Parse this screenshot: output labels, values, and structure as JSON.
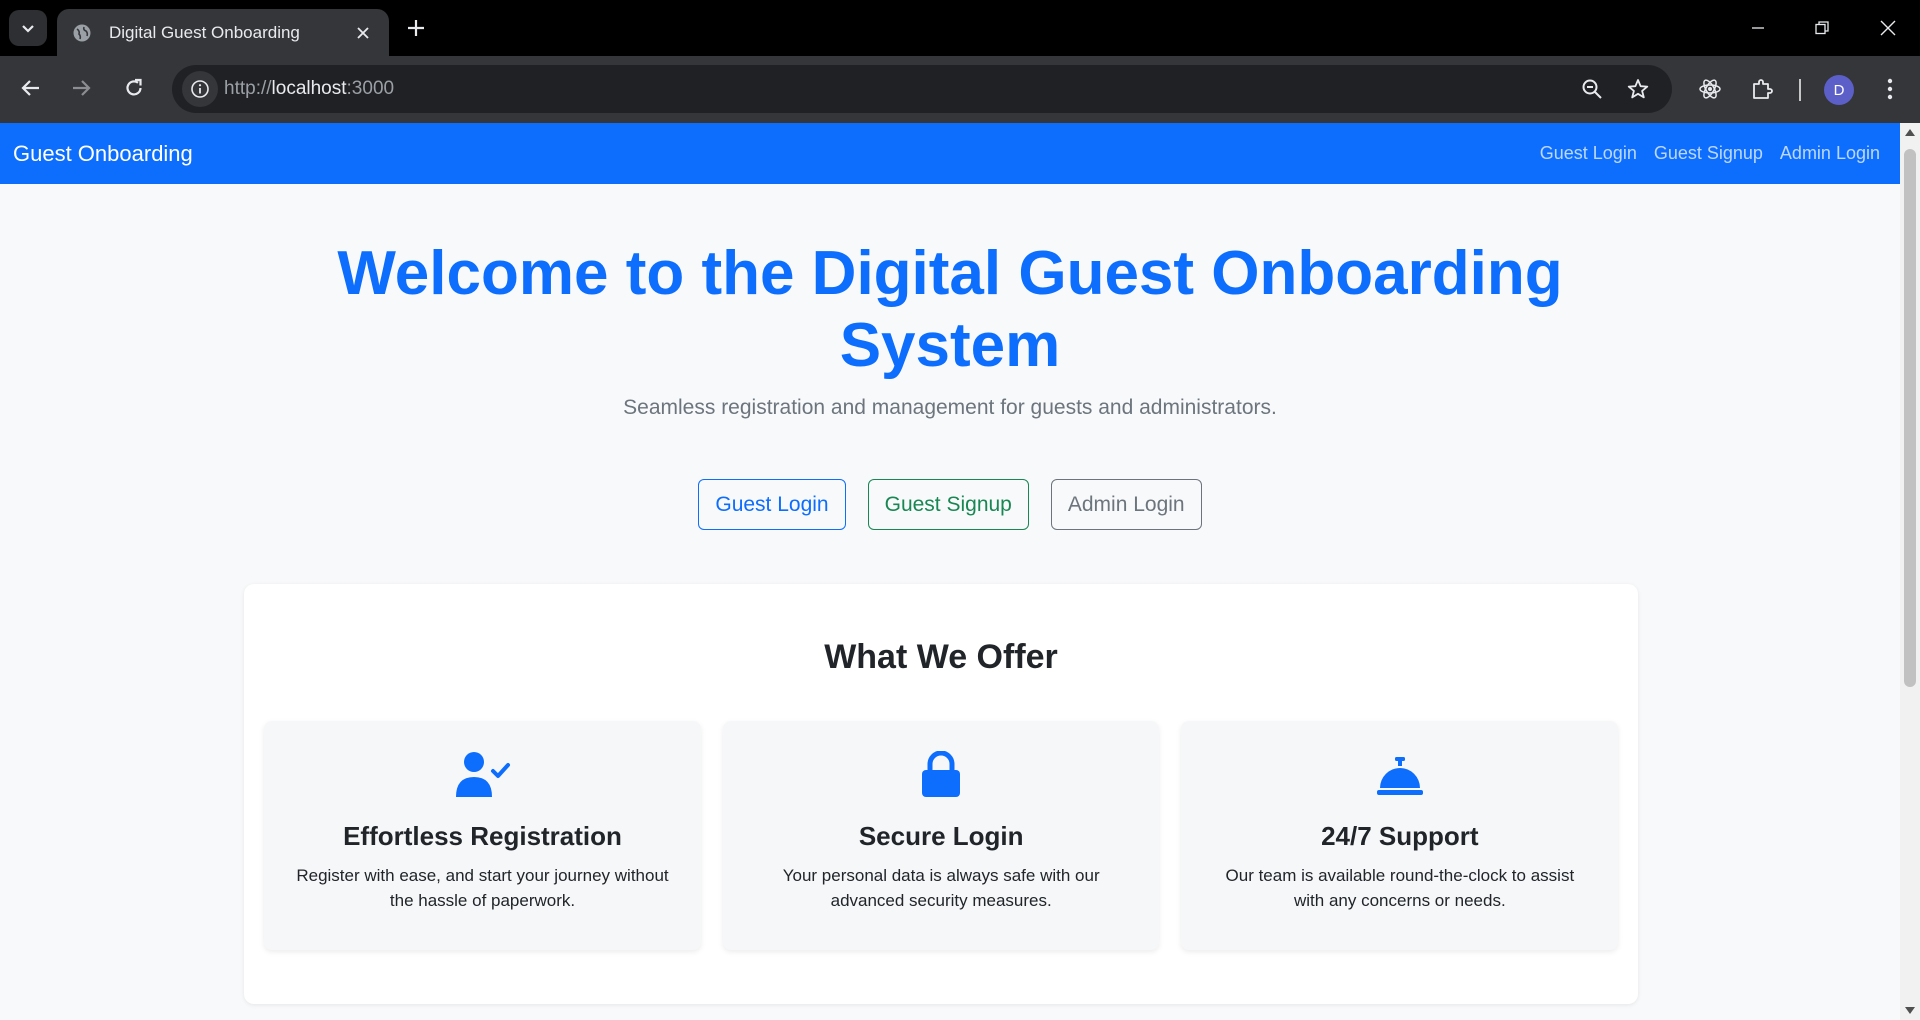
{
  "browser": {
    "tab": {
      "title": "Digital Guest Onboarding"
    },
    "url": {
      "scheme": "http://",
      "host": "localhost",
      "port": ":3000"
    },
    "profile_initial": "D"
  },
  "navbar": {
    "brand": "Guest Onboarding",
    "links": [
      "Guest Login",
      "Guest Signup",
      "Admin Login"
    ]
  },
  "hero": {
    "title_line1": "Welcome to the Digital Guest Onboarding",
    "title_line2": "System",
    "subtitle": "Seamless registration and management for guests and administrators.",
    "buttons": [
      "Guest Login",
      "Guest Signup",
      "Admin Login"
    ]
  },
  "offer": {
    "title": "What We Offer",
    "features": [
      {
        "icon": "user-check-icon",
        "title": "Effortless Registration",
        "description": "Register with ease, and start your journey without the hassle of paperwork."
      },
      {
        "icon": "lock-icon",
        "title": "Secure Login",
        "description": "Your personal data is always safe with our advanced security measures."
      },
      {
        "icon": "concierge-bell-icon",
        "title": "24/7 Support",
        "description": "Our team is available round-the-clock to assist with any concerns or needs."
      }
    ]
  },
  "colors": {
    "primary": "#0d6efd",
    "success": "#198754",
    "secondary": "#6c757d",
    "page_bg": "#f8f9fa"
  }
}
